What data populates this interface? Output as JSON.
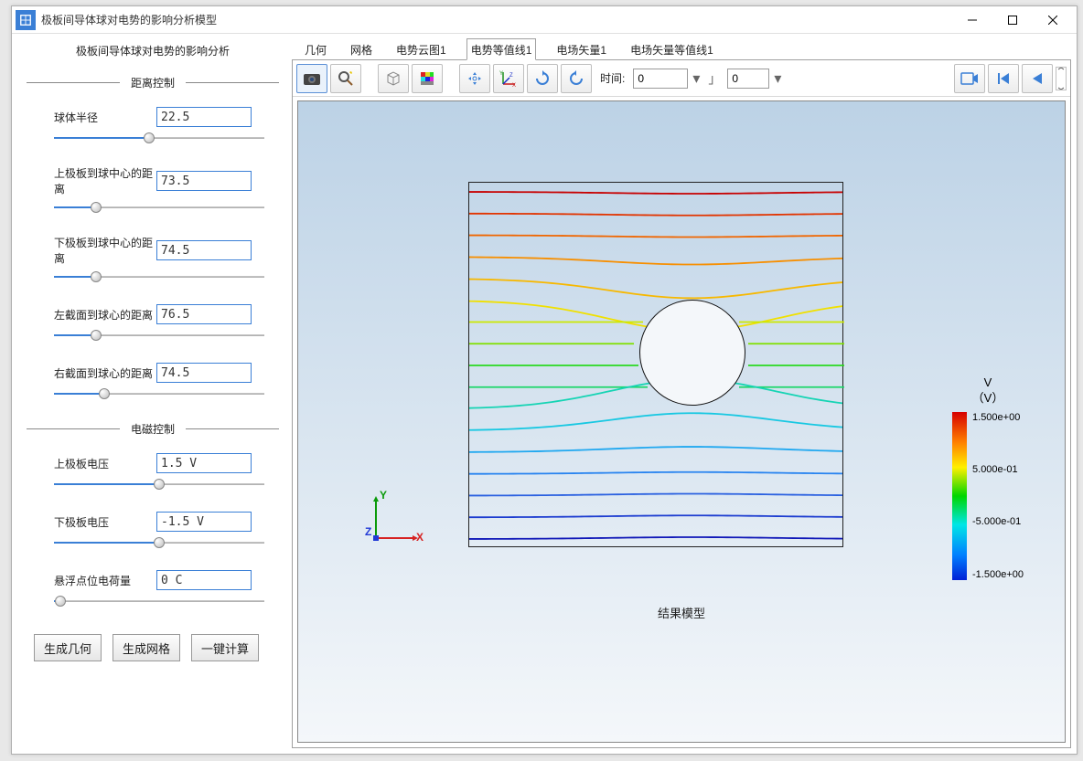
{
  "window": {
    "title": "极板间导体球对电势的影响分析模型"
  },
  "sidebar": {
    "title": "极板间导体球对电势的影响分析",
    "group1": {
      "title": "距离控制",
      "fields": [
        {
          "label": "球体半径",
          "value": "22.5",
          "pos": 45
        },
        {
          "label": "上极板到球中心的距离",
          "value": "73.5",
          "pos": 20
        },
        {
          "label": "下极板到球中心的距离",
          "value": "74.5",
          "pos": 20
        },
        {
          "label": "左截面到球心的距离",
          "value": "76.5",
          "pos": 20
        },
        {
          "label": "右截面到球心的距离",
          "value": "74.5",
          "pos": 24
        }
      ]
    },
    "group2": {
      "title": "电磁控制",
      "fields": [
        {
          "label": "上极板电压",
          "value": "1.5 V",
          "pos": 50
        },
        {
          "label": "下极板电压",
          "value": "-1.5 V",
          "pos": 50
        },
        {
          "label": "悬浮点位电荷量",
          "value": "0 C",
          "pos": 3
        }
      ]
    },
    "buttons": {
      "gen_geom": "生成几何",
      "gen_mesh": "生成网格",
      "compute": "一键计算"
    }
  },
  "tabs": {
    "items": [
      "几何",
      "网格",
      "电势云图1",
      "电势等值线1",
      "电场矢量1",
      "电场矢量等值线1"
    ],
    "active": 3
  },
  "toolbar": {
    "time_label": "时间:",
    "time_value": "0",
    "step_value": "0"
  },
  "plot": {
    "caption": "结果模型",
    "axes": {
      "x": "X",
      "y": "Y",
      "z": "Z"
    },
    "legend": {
      "title_line1": "V",
      "title_line2": "（V）",
      "ticks": [
        "1.500e+00",
        "5.000e-01",
        "-5.000e-01",
        "-1.500e+00"
      ]
    }
  }
}
